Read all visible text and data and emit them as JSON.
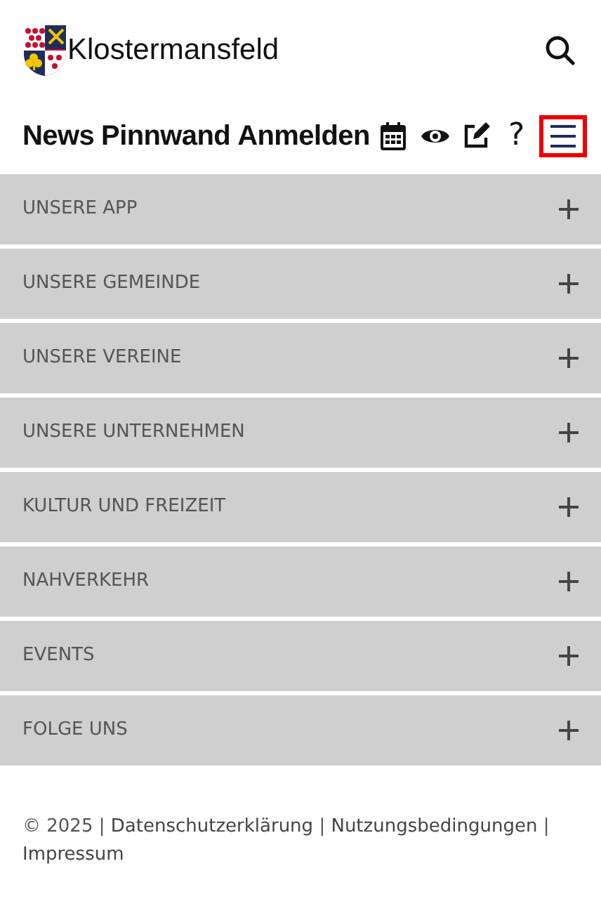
{
  "header": {
    "site_name": "Klostermansfeld"
  },
  "nav": {
    "links": [
      "News",
      "Pinnwand",
      "Anmelden"
    ],
    "tools": [
      {
        "kind": "calendar"
      },
      {
        "kind": "eye"
      },
      {
        "kind": "edit"
      },
      {
        "kind": "help",
        "label": "?"
      },
      {
        "kind": "menu",
        "highlighted": true
      }
    ]
  },
  "sections": [
    {
      "title": "UNSERE APP",
      "expanded": false
    },
    {
      "title": "UNSERE GEMEINDE",
      "expanded": false
    },
    {
      "title": "UNSERE VEREINE",
      "expanded": false
    },
    {
      "title": "UNSERE UNTERNEHMEN",
      "expanded": false
    },
    {
      "title": "KULTUR UND FREIZEIT",
      "expanded": false
    },
    {
      "title": "NAHVERKEHR",
      "expanded": false
    },
    {
      "title": "EVENTS",
      "expanded": false
    },
    {
      "title": "FOLGE UNS",
      "expanded": false
    }
  ],
  "footer": [
    {
      "kind": "text",
      "text": "© 2025"
    },
    {
      "kind": "text",
      "text": "|"
    },
    {
      "kind": "link",
      "text": "Datenschutzerklärung"
    },
    {
      "kind": "text",
      "text": "|"
    },
    {
      "kind": "link",
      "text": "Nutzungsbedingungen"
    },
    {
      "kind": "text",
      "text": "|"
    },
    {
      "kind": "link",
      "text": "Impressum"
    }
  ]
}
